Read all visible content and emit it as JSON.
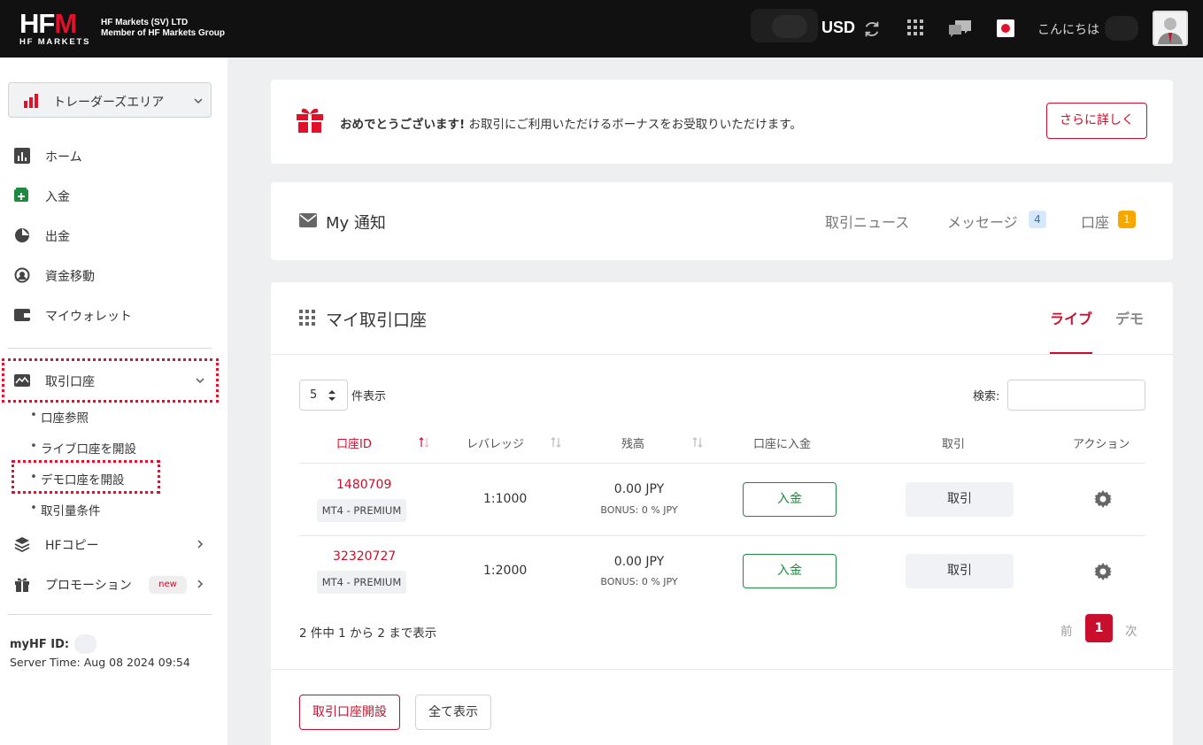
{
  "header": {
    "logo_main": "HF",
    "logo_m": "M",
    "logo_sub": "HF MARKETS",
    "company_line1": "HF Markets (SV) LTD",
    "company_line2": "Member of HF Markets Group",
    "currency": "USD",
    "greeting": "こんにちは"
  },
  "sidebar": {
    "area_select": "トレーダーズエリア",
    "nav": {
      "home": "ホーム",
      "deposit": "入金",
      "withdraw": "出金",
      "transfer": "資金移動",
      "wallet": "マイウォレット",
      "trading_accounts": "取引口座",
      "hf_copy": "HFコピー",
      "promotions": "プロモーション",
      "new_badge": "new"
    },
    "sub_items": {
      "view": "口座参照",
      "open_live": "ライブ口座を開設",
      "open_demo": "デモ口座を開設",
      "volume": "取引量条件"
    },
    "myhf_label": "myHF ID:",
    "server_time": "Server Time: Aug 08 2024 09:54"
  },
  "bonus_banner": {
    "bold": "おめでとうございます!",
    "text": " お取引にご利用いただけるボーナスをお受取りいただけます。",
    "button": "さらに詳しく"
  },
  "notifications": {
    "title": "My 通知",
    "tabs": {
      "news": "取引ニュース",
      "messages": "メッセージ",
      "messages_count": "4",
      "accounts": "口座",
      "accounts_count": "1"
    }
  },
  "accounts": {
    "title": "マイ取引口座",
    "tab_live": "ライブ",
    "tab_demo": "デモ",
    "page_length": "5",
    "page_length_label": "件表示",
    "search_label": "検索:",
    "search_value": "",
    "columns": [
      "口座ID",
      "レバレッジ",
      "残高",
      "口座に入金",
      "取引",
      "アクション"
    ],
    "rows": [
      {
        "id": "1480709",
        "type": "MT4 - PREMIUM",
        "leverage": "1:1000",
        "balance": "0.00 JPY",
        "bonus": "BONUS: 0 % JPY",
        "deposit": "入金",
        "trade": "取引"
      },
      {
        "id": "32320727",
        "type": "MT4 - PREMIUM",
        "leverage": "1:2000",
        "balance": "0.00 JPY",
        "bonus": "BONUS: 0 % JPY",
        "deposit": "入金",
        "trade": "取引"
      }
    ],
    "info": "2 件中 1 から 2 まで表示",
    "prev": "前",
    "page": "1",
    "next": "次",
    "open_account_button": "取引口座開設",
    "show_all_button": "全て表示"
  },
  "colors": {
    "brand_red": "#c8102e",
    "deposit_green": "#1f8a3f",
    "topbar": "#111111"
  }
}
